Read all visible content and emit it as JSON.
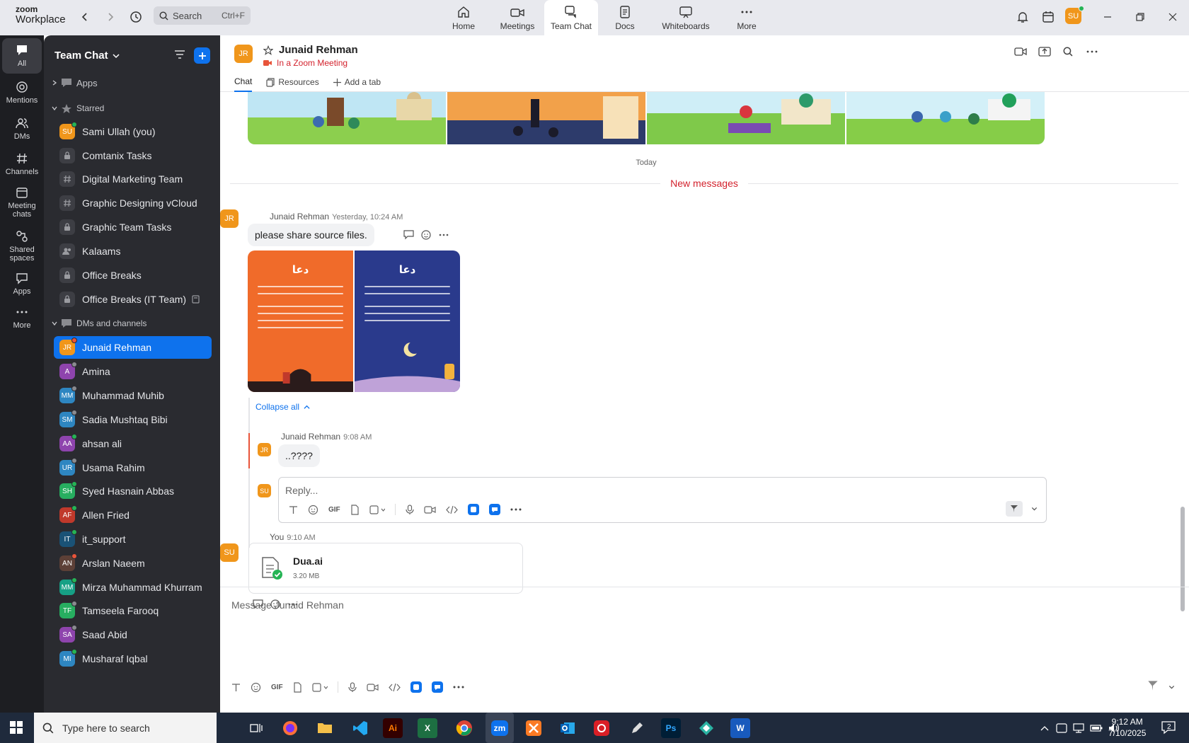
{
  "titlebar": {
    "brand_line1": "zoom",
    "brand_line2": "Workplace",
    "search_placeholder": "Search",
    "search_shortcut": "Ctrl+F",
    "nav": [
      {
        "label": "Home",
        "icon": "home-icon"
      },
      {
        "label": "Meetings",
        "icon": "video-icon"
      },
      {
        "label": "Team Chat",
        "icon": "chat-icon",
        "active": true
      },
      {
        "label": "Docs",
        "icon": "doc-icon"
      },
      {
        "label": "Whiteboards",
        "icon": "whiteboard-icon"
      },
      {
        "label": "More",
        "icon": "more-icon"
      }
    ],
    "user_initials": "SU"
  },
  "rail": [
    {
      "label": "All",
      "active": true
    },
    {
      "label": "Mentions"
    },
    {
      "label": "DMs"
    },
    {
      "label": "Channels"
    },
    {
      "label": "Meeting chats"
    },
    {
      "label": "Shared spaces"
    },
    {
      "label": "Apps"
    },
    {
      "label": "More"
    }
  ],
  "sidebar": {
    "title": "Team Chat",
    "sections": {
      "apps": "Apps",
      "starred": "Starred",
      "dms": "DMs and channels"
    },
    "starred": [
      {
        "initials": "SU",
        "label": "Sami Ullah (you)",
        "color": "#f0961b"
      },
      {
        "label": "Comtanix Tasks"
      },
      {
        "label": "Digital Marketing Team"
      },
      {
        "label": "Graphic Designing vCloud"
      },
      {
        "label": "Graphic Team Tasks"
      },
      {
        "label": "Kalaams"
      },
      {
        "label": "Office Breaks"
      },
      {
        "label": "Office Breaks (IT Team)"
      }
    ],
    "dms": [
      {
        "initials": "JR",
        "label": "Junaid Rehman",
        "color": "#f0961b",
        "active": true
      },
      {
        "initials": "A",
        "label": "Amina",
        "color": "#8e44ad"
      },
      {
        "initials": "MM",
        "label": "Muhammad Muhib",
        "color": "#2e86c1"
      },
      {
        "initials": "SM",
        "label": "Sadia Mushtaq Bibi",
        "color": "#2e86c1"
      },
      {
        "initials": "AA",
        "label": "ahsan ali",
        "color": "#8e44ad"
      },
      {
        "initials": "UR",
        "label": "Usama Rahim",
        "color": "#2e86c1"
      },
      {
        "initials": "SH",
        "label": "Syed Hasnain Abbas",
        "color": "#27ae60"
      },
      {
        "initials": "AF",
        "label": "Allen Fried",
        "color": "#c0392b"
      },
      {
        "initials": "IT",
        "label": "it_support",
        "color": "#1a5276"
      },
      {
        "initials": "AN",
        "label": "Arslan Naeem",
        "color": "#5d4037"
      },
      {
        "initials": "MM",
        "label": "Mirza Muhammad Khurram",
        "color": "#16a085"
      },
      {
        "initials": "TF",
        "label": "Tamseela Farooq",
        "color": "#27ae60"
      },
      {
        "initials": "SA",
        "label": "Saad Abid",
        "color": "#8e44ad"
      },
      {
        "initials": "MI",
        "label": "Musharaf Iqbal",
        "color": "#2e86c1"
      }
    ]
  },
  "chat": {
    "contact_initials": "JR",
    "contact_name": "Junaid Rehman",
    "contact_status": "In a Zoom Meeting",
    "tabs": [
      "Chat",
      "Resources",
      "Add a tab"
    ],
    "today": "Today",
    "new_messages": "New messages",
    "msg1": {
      "author": "Junaid Rehman",
      "time": "Yesterday, 10:24 AM",
      "text": "please share source files."
    },
    "image_cards": [
      {
        "title": "دعا",
        "color": "#f06b2a"
      },
      {
        "title": "دعا",
        "color": "#2a3a8c"
      }
    ],
    "collapse": "Collapse all",
    "reply": {
      "author": "Junaid Rehman",
      "time": "9:08 AM",
      "text": "..????",
      "initials": "JR"
    },
    "reply_placeholder": "Reply...",
    "reply_user_initials": "SU",
    "gif_label": "GIF",
    "msg2": {
      "author": "You",
      "time": "9:10 AM",
      "initials": "SU"
    },
    "file": {
      "name": "Dua.ai",
      "size": "3.20 MB"
    },
    "compose_placeholder": "Message Junaid Rehman"
  },
  "taskbar": {
    "search_placeholder": "Type here to search",
    "apps": [
      "Ai",
      "X",
      "zm",
      "Ps",
      "W"
    ],
    "time": "9:12 AM",
    "date": "7/10/2025",
    "notifications": "2"
  }
}
